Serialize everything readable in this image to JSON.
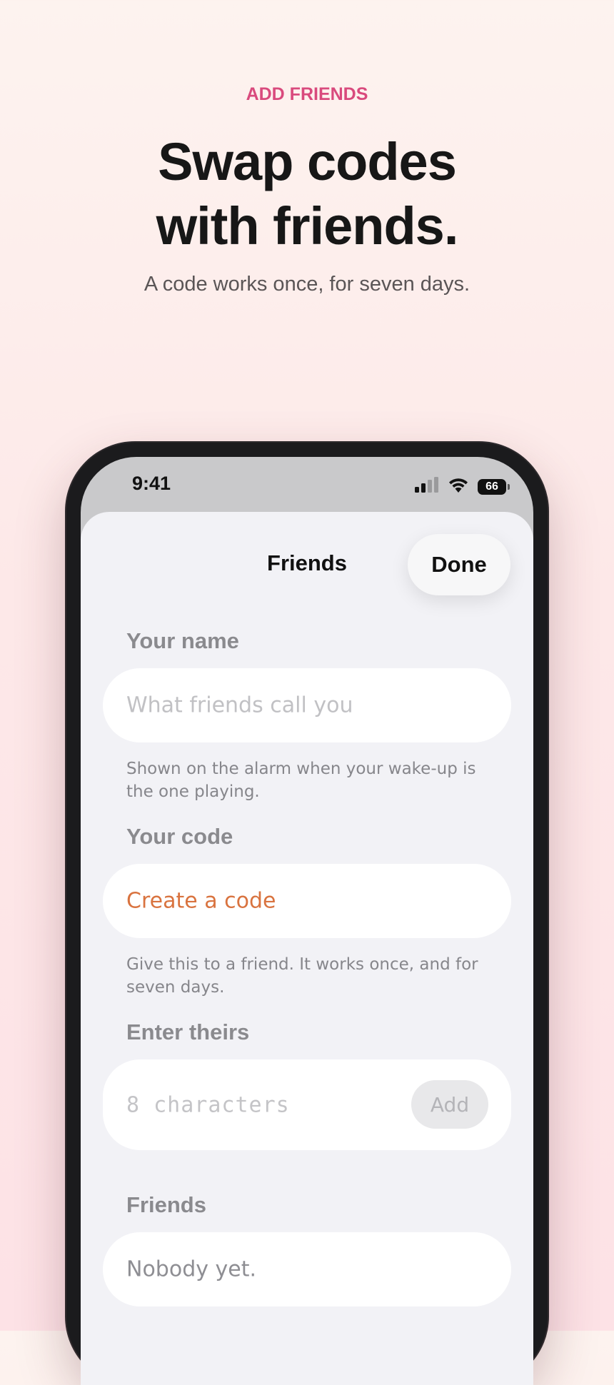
{
  "header": {
    "eyebrow": "ADD FRIENDS",
    "headline_line1": "Swap codes",
    "headline_line2": "with friends.",
    "subhead": "A code works once, for seven days."
  },
  "status_bar": {
    "time": "9:41",
    "battery": "66"
  },
  "sheet": {
    "title": "Friends",
    "done_label": "Done",
    "name_section": {
      "label": "Your name",
      "placeholder": "What friends call you",
      "help": "Shown on the alarm when your wake-up is the one playing."
    },
    "code_section": {
      "label": "Your code",
      "action": "Create a code",
      "help": "Give this to a friend. It works once, and for seven days."
    },
    "enter_section": {
      "label": "Enter theirs",
      "placeholder": "8 characters",
      "add_label": "Add"
    },
    "friends_section": {
      "label": "Friends",
      "empty": "Nobody yet."
    }
  },
  "colors": {
    "accent_pink": "#d94a7d",
    "accent_orange": "#d9733f",
    "sheet_background": "#f2f2f6"
  }
}
